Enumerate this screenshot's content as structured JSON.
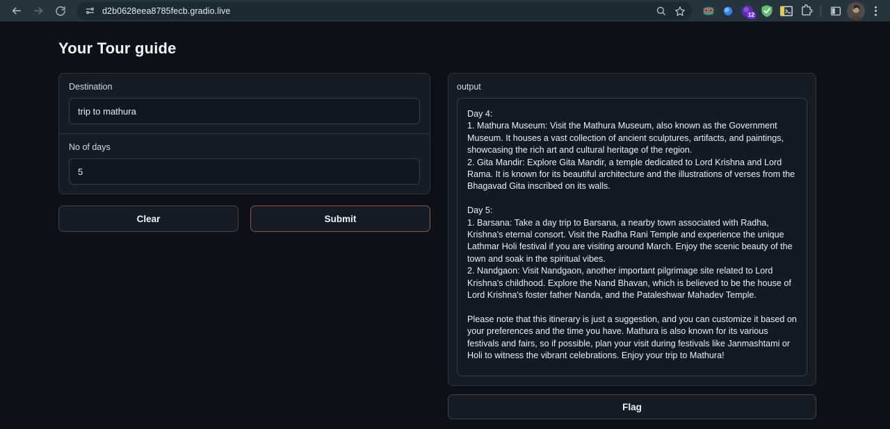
{
  "browser": {
    "back_label": "Back",
    "forward_label": "Forward",
    "reload_label": "Reload",
    "url": "d2b0628eea8785fecb.gradio.live",
    "site_settings_icon": "tune-sliders-icon",
    "zoom_icon": "search-zoom-icon",
    "bookmark_icon": "star-icon",
    "extensions": [
      {
        "name": "goggles-extension-icon",
        "color": "#d94a4a",
        "badge": ""
      },
      {
        "name": "blue-orb-extension-icon",
        "color": "#2a7fd4",
        "badge": ""
      },
      {
        "name": "purple-badge-extension-icon",
        "color": "#7b2ff7",
        "badge": "12"
      },
      {
        "name": "adguard-shield-icon",
        "color": "#68bc71",
        "badge": ""
      },
      {
        "name": "terminal-console-icon",
        "color": "#e6c84f",
        "badge": ""
      },
      {
        "name": "puzzle-extensions-icon",
        "color": "#c3cdd4",
        "badge": ""
      }
    ],
    "side_panel_icon": "side-panel-icon",
    "profile_label": "Profile",
    "menu_label": "Customize and control Chrome"
  },
  "app": {
    "title": "Your Tour guide",
    "form": {
      "destination": {
        "label": "Destination",
        "value": "trip to mathura",
        "placeholder": ""
      },
      "days": {
        "label": "No of days",
        "value": "5",
        "placeholder": ""
      },
      "clear_label": "Clear",
      "submit_label": "Submit",
      "submit_accent": "#8a5a44"
    },
    "output": {
      "label": "output",
      "text": "Day 4:\n1. Mathura Museum: Visit the Mathura Museum, also known as the Government Museum. It houses a vast collection of ancient sculptures, artifacts, and paintings, showcasing the rich art and cultural heritage of the region.\n2. Gita Mandir: Explore Gita Mandir, a temple dedicated to Lord Krishna and Lord Rama. It is known for its beautiful architecture and the illustrations of verses from the Bhagavad Gita inscribed on its walls.\n\nDay 5:\n1. Barsana: Take a day trip to Barsana, a nearby town associated with Radha, Krishna's eternal consort. Visit the Radha Rani Temple and experience the unique Lathmar Holi festival if you are visiting around March. Enjoy the scenic beauty of the town and soak in the spiritual vibes.\n2. Nandgaon: Visit Nandgaon, another important pilgrimage site related to Lord Krishna's childhood. Explore the Nand Bhavan, which is believed to be the house of Lord Krishna's foster father Nanda, and the Pataleshwar Mahadev Temple.\n\nPlease note that this itinerary is just a suggestion, and you can customize it based on your preferences and the time you have. Mathura is also known for its various festivals and fairs, so if possible, plan your visit during festivals like Janmashtami or Holi to witness the vibrant celebrations. Enjoy your trip to Mathura!",
      "flag_label": "Flag"
    }
  },
  "theme": {
    "page_background": "#0d1117",
    "panel_background": "#161c26",
    "toolbar_background": "#26343d"
  }
}
